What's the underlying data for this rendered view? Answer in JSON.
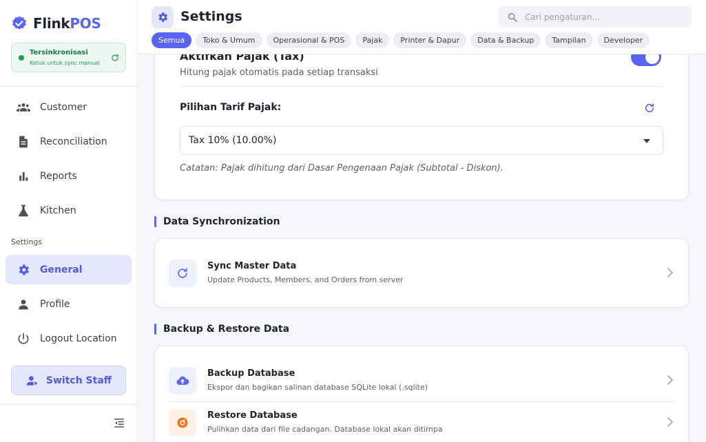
{
  "brand": {
    "name_main": "Flink",
    "name_accent": "POS"
  },
  "sync": {
    "title": "Tersinkronisasi",
    "subtitle": "Ketuk untuk sync manual"
  },
  "sidebar": {
    "items": [
      {
        "label": "Customer",
        "icon": "people-icon"
      },
      {
        "label": "Reconciliation",
        "icon": "document-icon"
      },
      {
        "label": "Reports",
        "icon": "bar-chart-icon"
      },
      {
        "label": "Kitchen",
        "icon": "flask-icon"
      }
    ],
    "section_label": "Settings",
    "settings_items": [
      {
        "label": "General",
        "icon": "gear-icon",
        "active": true
      },
      {
        "label": "Profile",
        "icon": "person-icon"
      },
      {
        "label": "Logout Location",
        "icon": "power-icon"
      }
    ],
    "switch_staff": "Switch Staff"
  },
  "header": {
    "title": "Settings",
    "search_placeholder": "Cari pengaturan...",
    "tabs": [
      "Semua",
      "Toko & Umum",
      "Operasional & POS",
      "Pajak",
      "Printer & Dapur",
      "Data & Backup",
      "Tampilan",
      "Developer"
    ],
    "active_tab": "Semua"
  },
  "tax": {
    "title": "Aktifkan Pajak (Tax)",
    "subtitle": "Hitung pajak otomatis pada setiap transaksi",
    "enabled": true,
    "rate_label": "Pilihan Tarif Pajak:",
    "rate_value": "Tax 10% (10.00%)",
    "note": "Catatan: Pajak dihitung dari Dasar Pengenaan Pajak (Subtotal - Diskon)."
  },
  "data_sync": {
    "heading": "Data Synchronization",
    "item": {
      "title": "Sync Master Data",
      "subtitle": "Update Products, Members, and Orders from server"
    }
  },
  "backup": {
    "heading": "Backup & Restore Data",
    "items": [
      {
        "title": "Backup Database",
        "subtitle": "Ekspor dan bagikan salinan database SQLite lokal (.sqlite)"
      },
      {
        "title": "Restore Database",
        "subtitle": "Pulihkan data dari file cadangan. Database lokal akan ditimpa"
      }
    ]
  },
  "colors": {
    "accent": "#5865f2",
    "sync_green": "#16a34a",
    "restore_orange": "#f97316"
  }
}
